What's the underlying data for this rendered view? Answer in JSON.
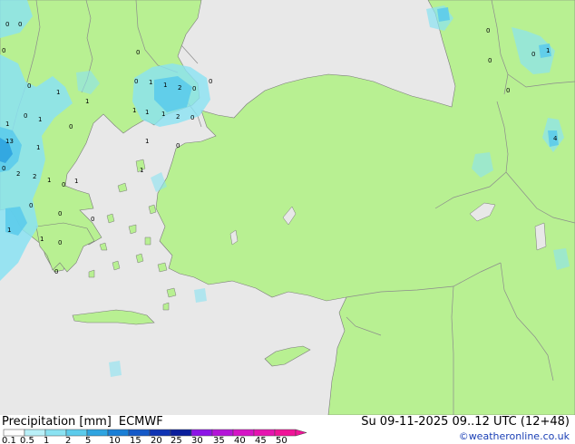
{
  "footer": {
    "title": "Precipitation [mm]",
    "model": "ECMWF",
    "valid_time": "Su 09-11-2025 09..12 UTC (12+48)",
    "credit": "©weatheronline.co.uk"
  },
  "scale": {
    "labels": [
      "0.1",
      "0.5",
      "1",
      "2",
      "5",
      "10",
      "15",
      "20",
      "25",
      "30",
      "35",
      "40",
      "45",
      "50"
    ],
    "colors": [
      "#fefefe",
      "#b9f0f8",
      "#8ae2f2",
      "#5ccbeb",
      "#2fa4e0",
      "#1a7fd6",
      "#1559c8",
      "#1034b4",
      "#0a1e9c",
      "#8c14e6",
      "#b414d8",
      "#d614c6",
      "#e614b0",
      "#f01498"
    ]
  },
  "map": {
    "colors": {
      "sea": "#e8e8e8",
      "land": "#b8f092",
      "border": "#8c8c8c",
      "coast": "#7a7a7a"
    },
    "point_values": [
      {
        "v": "0"
      },
      {
        "v": "0"
      },
      {
        "v": "0"
      },
      {
        "v": "0"
      },
      {
        "v": "0"
      },
      {
        "v": "1"
      },
      {
        "v": "0"
      },
      {
        "v": "1"
      },
      {
        "v": "0"
      },
      {
        "v": "1"
      },
      {
        "v": "2"
      },
      {
        "v": "0"
      },
      {
        "v": "1"
      },
      {
        "v": "1"
      },
      {
        "v": "1"
      },
      {
        "v": "2"
      },
      {
        "v": "0"
      },
      {
        "v": "0"
      },
      {
        "v": "1"
      },
      {
        "v": "1"
      },
      {
        "v": "1"
      },
      {
        "v": "0"
      },
      {
        "v": "13"
      },
      {
        "v": "1"
      },
      {
        "v": "0"
      },
      {
        "v": "2"
      },
      {
        "v": "2"
      },
      {
        "v": "1"
      },
      {
        "v": "0"
      },
      {
        "v": "1"
      },
      {
        "v": "0"
      },
      {
        "v": "0"
      },
      {
        "v": "1"
      },
      {
        "v": "1"
      },
      {
        "v": "0"
      },
      {
        "v": "0"
      },
      {
        "v": "0"
      },
      {
        "v": "1"
      },
      {
        "v": "1"
      },
      {
        "v": "0"
      },
      {
        "v": "0"
      },
      {
        "v": "0"
      },
      {
        "v": "0"
      },
      {
        "v": "0"
      },
      {
        "v": "1"
      },
      {
        "v": "4"
      }
    ]
  }
}
